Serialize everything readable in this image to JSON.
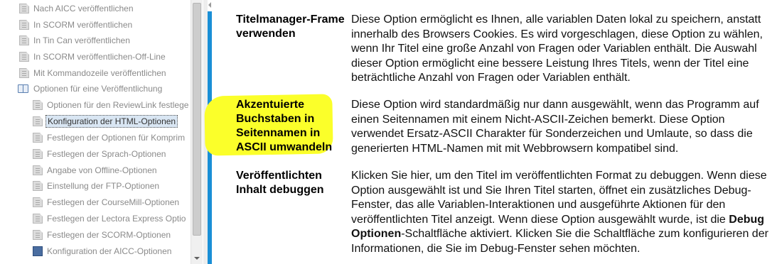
{
  "toc": {
    "items": [
      {
        "label": "Nach AICC veröffentlichen",
        "icon": "page-icon",
        "level": 0
      },
      {
        "label": "In SCORM veröffentlichen",
        "icon": "page-icon",
        "level": 0
      },
      {
        "label": "In Tin Can veröffentlichen",
        "icon": "page-icon",
        "level": 0
      },
      {
        "label": "In SCORM veröffentlichen-Off-Line",
        "icon": "page-icon",
        "level": 0
      },
      {
        "label": "Mit Kommandozeile veröffentlichen",
        "icon": "page-icon",
        "level": 0
      },
      {
        "label": "Optionen für eine Veröffentlichung",
        "icon": "open-book-icon",
        "level": 0
      },
      {
        "label": "Optionen für den ReviewLink festlege",
        "icon": "page-icon",
        "level": 1
      },
      {
        "label": "Konfiguration der HTML-Optionen",
        "icon": "page-icon",
        "level": 1,
        "selected": true
      },
      {
        "label": "Festlegen der Optionen für Komprim",
        "icon": "page-icon",
        "level": 1
      },
      {
        "label": "Festlegen der Sprach-Optionen",
        "icon": "page-icon",
        "level": 1
      },
      {
        "label": "Angabe von Offline-Optionen",
        "icon": "page-icon",
        "level": 1
      },
      {
        "label": "Einstellung der FTP-Optionen",
        "icon": "page-icon",
        "level": 1
      },
      {
        "label": "Festlegen der CourseMill-Optionen",
        "icon": "page-icon",
        "level": 1
      },
      {
        "label": "Festlegen der Lectora Express Optio",
        "icon": "page-icon",
        "level": 1
      },
      {
        "label": "Festlegen der SCORM-Optionen",
        "icon": "page-icon",
        "level": 1
      },
      {
        "label": "Konfiguration der AICC-Optionen",
        "icon": "blue-document-icon",
        "level": 1
      }
    ]
  },
  "content": {
    "rows": [
      {
        "term": "Titelmanager-Frame verwenden",
        "description": "Diese Option ermöglicht es Ihnen, alle variablen Daten lokal zu speichern, anstatt innerhalb des Browsers Cookies. Es wird vorgeschlagen, diese Option zu wählen, wenn Ihr Titel eine große Anzahl von Fragen oder Variablen enthält. Die Auswahl dieser Option ermöglicht eine bessere Leistung Ihres Titels, wenn der Titel eine beträchtliche Anzahl von Fragen oder Variablen enthält."
      },
      {
        "term": "Akzentuierte Buchstaben in Seitennamen in ASCII umwandeln",
        "description": "Diese Option wird standardmäßig nur dann ausgewählt, wenn das Programm auf einen Seitennamen mit einem Nicht-ASCII-Zeichen bemerkt. Diese Option verwendet Ersatz-ASCII Charakter für Sonderzeichen und Umlaute, so dass die generierten HTML-Namen mit mit Webbrowsern kompatibel sind.",
        "highlighted": true,
        "highlight_color": "#fbff2a"
      },
      {
        "term": "Veröffentlichten Inhalt debuggen",
        "description_before": "Klicken Sie hier, um den Titel im veröffentlichten Format zu debuggen. Wenn diese Option ausgewählt ist und Sie Ihren Titel starten, öffnet ein zusätzliches Debug-Fenster, das alle Variablen-Interaktionen und ausgeführte Aktionen für den veröffentlichten Titel anzeigt. Wenn diese Option ausgewählt wurde, ist die ",
        "description_bold": "Debug Optionen",
        "description_after": "-Schaltfläche aktiviert. Klicken Sie die Schaltfläche zum konfigurieren der Informationen, die Sie im Debug-Fenster sehen möchten."
      }
    ]
  },
  "colors": {
    "accent_bar": "#1a8fd6",
    "selection_bg": "#d9e6f3",
    "highlight": "#fbff2a"
  }
}
